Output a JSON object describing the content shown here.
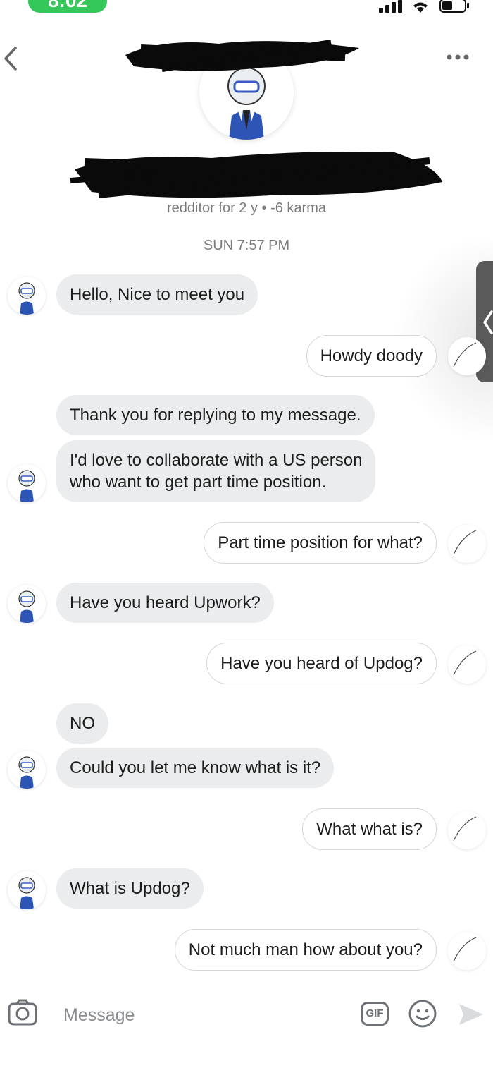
{
  "status_bar": {
    "time": "8:02"
  },
  "profile": {
    "meta": "redditor for 2 y • -6 karma"
  },
  "conversation": {
    "date": "SUN 7:57 PM",
    "messages": [
      {
        "side": "in",
        "text": "Hello, Nice to meet you"
      },
      {
        "side": "out",
        "text": "Howdy doody"
      },
      {
        "side": "in",
        "text": "Thank you for replying to my message."
      },
      {
        "side": "in",
        "text": "I'd love to collaborate with a US person\nwho want to get part time position."
      },
      {
        "side": "out",
        "text": "Part time position for what?"
      },
      {
        "side": "in",
        "text": "Have you heard Upwork?"
      },
      {
        "side": "out",
        "text": "Have you heard of Updog?"
      },
      {
        "side": "in",
        "text": "NO"
      },
      {
        "side": "in",
        "text": "Could you let me know what is it?"
      },
      {
        "side": "out",
        "text": "What what is?"
      },
      {
        "side": "in",
        "text": "What is Updog?"
      },
      {
        "side": "out",
        "text": "Not much man how about you?"
      }
    ]
  },
  "composer": {
    "placeholder": "Message",
    "gif_label": "GIF"
  },
  "icons": {
    "back": "chevron-left-icon",
    "more": "ellipsis-icon",
    "camera": "camera-icon",
    "gif": "gif-icon",
    "emoji": "smiley-icon",
    "send": "send-icon"
  },
  "colors": {
    "incoming_bubble": "#eaeced",
    "outgoing_border": "#d4d6d8",
    "status_green": "#34c759",
    "meta_text": "#7c7c7c"
  }
}
